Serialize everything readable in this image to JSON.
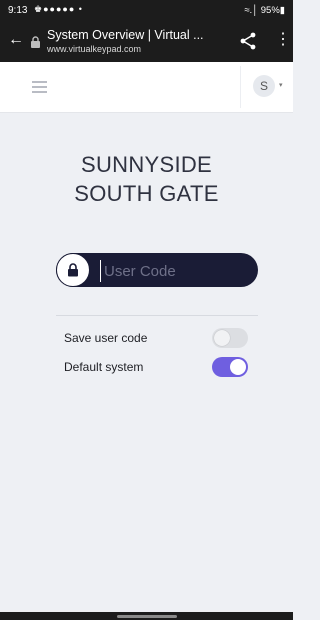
{
  "status_bar": {
    "time": "9:13",
    "notifications": "♚●●●●● •",
    "right": "≈.│ 95%▮"
  },
  "browser": {
    "back_icon": "back-arrow-icon",
    "title": "System Overview | Virtual ...",
    "url": "www.virtualkeypad.com",
    "share_icon": "share-icon",
    "menu_icon": "kebab-menu-icon"
  },
  "header": {
    "menu_icon": "hamburger-icon",
    "avatar_initial": "S",
    "caret": "▾"
  },
  "site": {
    "title_line1": "SUNNYSIDE",
    "title_line2": "SOUTH GATE"
  },
  "login": {
    "placeholder": "User Code",
    "value": ""
  },
  "settings": [
    {
      "label": "Save user code",
      "on": false
    },
    {
      "label": "Default system",
      "on": true
    }
  ],
  "colors": {
    "accent": "#6f5fe0",
    "field_bg": "#1a1c36",
    "page_bg": "#eef0f4"
  }
}
